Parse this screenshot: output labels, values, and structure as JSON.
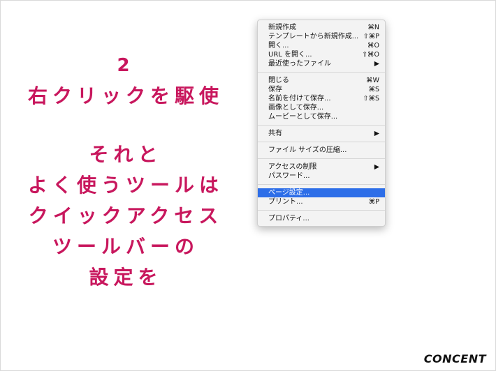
{
  "slide": {
    "number": "2",
    "heading": "右クリックを駆使",
    "body_lines": [
      "それと",
      "よく使うツールは",
      "クイックアクセス",
      "ツールバーの",
      "設定を"
    ]
  },
  "menu": {
    "groups": [
      [
        {
          "label": "新規作成",
          "shortcut": "⌘N"
        },
        {
          "label": "テンプレートから新規作成...",
          "shortcut": "⇧⌘P"
        },
        {
          "label": "開く...",
          "shortcut": "⌘O"
        },
        {
          "label": "URL を開く...",
          "shortcut": "⇧⌘O"
        },
        {
          "label": "最近使ったファイル",
          "arrow": "▶"
        }
      ],
      [
        {
          "label": "閉じる",
          "shortcut": "⌘W"
        },
        {
          "label": "保存",
          "shortcut": "⌘S"
        },
        {
          "label": "名前を付けて保存...",
          "shortcut": "⇧⌘S"
        },
        {
          "label": "画像として保存...",
          "shortcut": ""
        },
        {
          "label": "ムービーとして保存...",
          "shortcut": ""
        }
      ],
      [
        {
          "label": "共有",
          "arrow": "▶"
        }
      ],
      [
        {
          "label": "ファイル サイズの圧縮...",
          "shortcut": ""
        }
      ],
      [
        {
          "label": "アクセスの制限",
          "arrow": "▶"
        },
        {
          "label": "パスワード...",
          "shortcut": ""
        }
      ],
      [
        {
          "label": "ページ設定...",
          "shortcut": "",
          "selected": true
        },
        {
          "label": "プリント...",
          "shortcut": "⌘P"
        }
      ],
      [
        {
          "label": "プロパティ...",
          "shortcut": ""
        }
      ]
    ]
  },
  "logo": "CONCENT",
  "colors": {
    "accent": "#c8175d",
    "selection": "#2d6ee8"
  }
}
